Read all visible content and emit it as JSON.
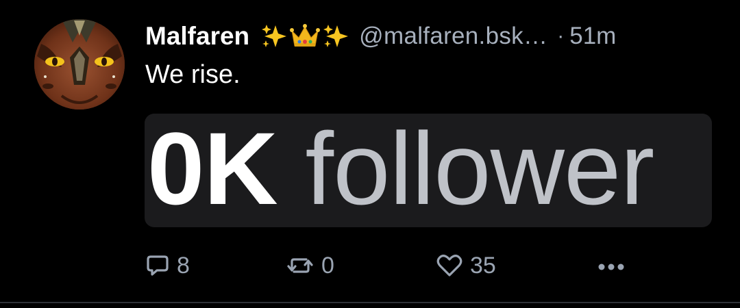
{
  "post": {
    "author": {
      "display_name": "Malfaren",
      "name_emojis": [
        "sparkles-emoji",
        "crown-emoji",
        "sparkles-emoji"
      ],
      "handle": "@malfaren.bsk…",
      "avatar": "dragon-avatar"
    },
    "separator": "·",
    "timestamp": "51m",
    "text": "We rise.",
    "embed_image": {
      "strong_text": "0K",
      "soft_text": " follower"
    },
    "actions": {
      "reply": {
        "icon": "reply-bubble-icon",
        "count": "8"
      },
      "repost": {
        "icon": "repost-arrows-icon",
        "count": "0"
      },
      "like": {
        "icon": "heart-icon",
        "count": "35"
      },
      "more": {
        "icon": "more-dots-icon"
      }
    }
  },
  "colors": {
    "background": "#000000",
    "text": "#ffffff",
    "muted": "#a7b0bd",
    "embed_bg": "#1b1b1d",
    "divider": "#2e3238"
  }
}
